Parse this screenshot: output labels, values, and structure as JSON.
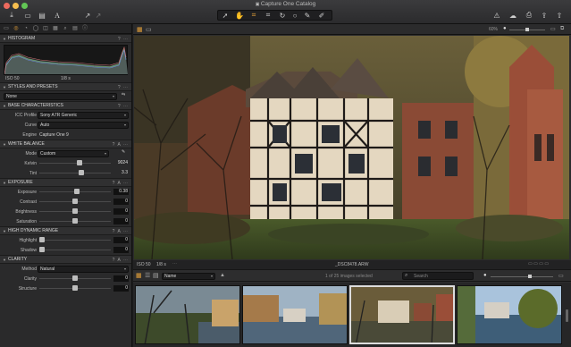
{
  "app": {
    "title": "Capture One Catalog"
  },
  "colors": {
    "accent": "#e9a43a",
    "panel": "#2a2a2b",
    "window_red": "#ed6a5e",
    "window_yellow": "#f5bf4f",
    "window_green": "#62c655"
  },
  "toolbar": {
    "left_icons": [
      "import-icon",
      "camera-icon",
      "browser-icon",
      "text-icon",
      "brush-icon",
      "picker-icon"
    ],
    "center_icons": [
      "select-cursor-icon",
      "pan-icon",
      "crop-icon",
      "rotate-icon",
      "keystone-icon",
      "circle-icon",
      "eyedropper-icon",
      "brush-tool-icon"
    ],
    "right_icons": [
      "warning-icon",
      "cloud-icon",
      "print-icon",
      "share-icon",
      "export-icon"
    ]
  },
  "tool_tabs": [
    "folder-tab",
    "capture-tab",
    "color-tab",
    "lens-tab",
    "exposure-tab",
    "metadata-tab",
    "search-tab",
    "details-tab",
    "info-tab"
  ],
  "histogram": {
    "header": "HISTOGRAM",
    "iso": "ISO 50",
    "shutter": "1/8 s"
  },
  "styles": {
    "header": "STYLES AND PRESETS",
    "selected": "None"
  },
  "base": {
    "header": "BASE CHARACTERISTICS",
    "icc_label": "ICC Profile",
    "icc_value": "Sony A7R Generic",
    "curve_label": "Curve",
    "curve_value": "Auto",
    "engine_label": "Engine",
    "engine_value": "Capture One 9"
  },
  "wb": {
    "header": "WHITE BALANCE",
    "mode_label": "Mode",
    "mode_value": "Custom",
    "kelvin_label": "Kelvin",
    "kelvin_value": "9024",
    "kelvin_level": 0.57,
    "tint_label": "Tint",
    "tint_value": "3.3",
    "tint_level": 0.6
  },
  "exposure": {
    "header": "EXPOSURE",
    "rows": [
      {
        "label": "Exposure",
        "value": "0.38",
        "level": 0.53
      },
      {
        "label": "Contrast",
        "value": "0",
        "level": 0.5
      },
      {
        "label": "Brightness",
        "value": "0",
        "level": 0.5
      },
      {
        "label": "Saturation",
        "value": "0",
        "level": 0.5
      }
    ]
  },
  "hdr": {
    "header": "HIGH DYNAMIC RANGE",
    "rows": [
      {
        "label": "Highlight",
        "value": "0",
        "level": 0.0
      },
      {
        "label": "Shadow",
        "value": "0",
        "level": 0.0
      }
    ]
  },
  "clarity": {
    "header": "CLARITY",
    "method_label": "Method",
    "method_value": "Natural",
    "rows": [
      {
        "label": "Clarity",
        "value": "0",
        "level": 0.5
      },
      {
        "label": "Structure",
        "value": "0",
        "level": 0.5
      }
    ]
  },
  "viewer": {
    "zoom": "60%",
    "iso": "ISO 50",
    "shutter": "1/8 s",
    "filename": "_DSC8478.ARW",
    "sort": "Name",
    "count": "1 of 25 images selected",
    "search_placeholder": "Search"
  }
}
